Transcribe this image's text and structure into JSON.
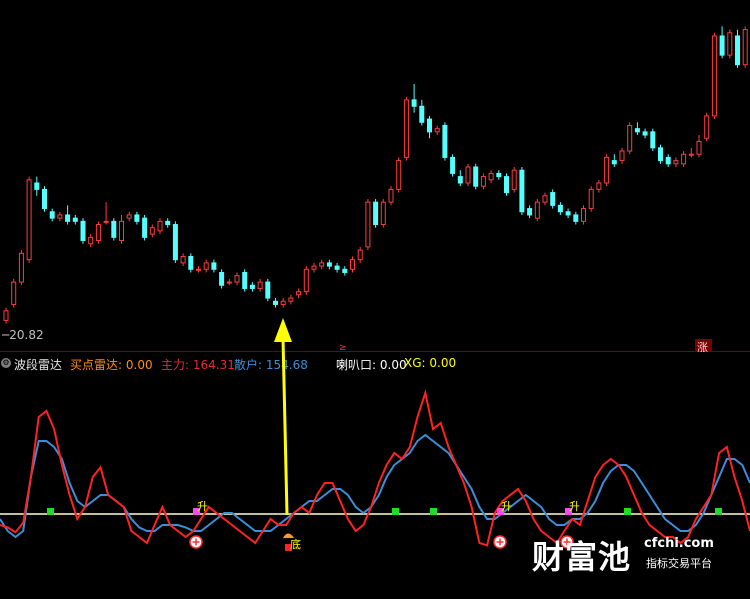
{
  "price_chart": {
    "last_price_label": "20.82",
    "marker_zhang": "涨",
    "marker_small": "≥",
    "bar_open": [
      19.3,
      19.8,
      20.5,
      21.2,
      23.6,
      23.4,
      22.7,
      22.5,
      22.6,
      22.5,
      22.4,
      21.7,
      21.8,
      22.4,
      22.4,
      21.8,
      22.5,
      22.6,
      22.5,
      22.0,
      22.1,
      22.4,
      22.3,
      21.1,
      21.3,
      20.9,
      20.9,
      21.1,
      20.8,
      20.5,
      20.5,
      20.8,
      20.4,
      20.3,
      20.5,
      19.9,
      19.8,
      19.9,
      20.1,
      20.2,
      20.9,
      21.0,
      21.1,
      21.0,
      20.9,
      20.9,
      21.2,
      21.6,
      23.0,
      22.3,
      23.0,
      23.4,
      24.4,
      26.2,
      26.0,
      25.6,
      25.2,
      25.4,
      24.4,
      23.8,
      23.6,
      24.1,
      23.5,
      23.7,
      23.9,
      23.8,
      23.4,
      24.0,
      22.8,
      22.5,
      23.0,
      23.3,
      22.9,
      22.7,
      22.6,
      22.4,
      22.8,
      23.4,
      23.6,
      24.3,
      24.3,
      24.6,
      25.3,
      25.2,
      25.2,
      24.7,
      24.4,
      24.2,
      24.2,
      24.5,
      24.5,
      25.0,
      25.7,
      28.2,
      27.6,
      28.2,
      27.3,
      28.3
    ],
    "bar_close": [
      19.6,
      20.5,
      21.4,
      23.7,
      23.4,
      22.8,
      22.5,
      22.6,
      22.4,
      22.4,
      21.8,
      21.9,
      22.3,
      22.4,
      21.9,
      22.4,
      22.6,
      22.4,
      21.9,
      22.2,
      22.4,
      22.3,
      21.2,
      21.3,
      20.9,
      20.9,
      21.1,
      20.9,
      20.4,
      20.5,
      20.7,
      20.3,
      20.3,
      20.5,
      20.0,
      19.8,
      19.9,
      20.0,
      20.2,
      20.9,
      21.0,
      21.1,
      21.0,
      20.9,
      20.8,
      21.2,
      21.5,
      23.0,
      22.3,
      23.0,
      23.4,
      24.3,
      26.2,
      26.0,
      25.5,
      25.2,
      25.3,
      24.4,
      23.9,
      23.6,
      24.1,
      23.5,
      23.8,
      23.9,
      23.8,
      23.3,
      24.0,
      22.7,
      22.6,
      23.0,
      23.2,
      22.9,
      22.7,
      22.6,
      22.4,
      22.8,
      23.4,
      23.6,
      24.4,
      24.2,
      24.6,
      25.4,
      25.2,
      25.1,
      24.7,
      24.3,
      24.2,
      24.3,
      24.5,
      24.5,
      24.9,
      25.7,
      28.2,
      27.6,
      28.3,
      27.3,
      28.4,
      27.6
    ],
    "bar_high": [
      19.7,
      20.6,
      21.5,
      23.8,
      23.8,
      23.5,
      22.8,
      22.7,
      22.9,
      22.6,
      22.5,
      22.0,
      22.4,
      23.0,
      22.5,
      22.6,
      22.7,
      22.7,
      22.6,
      22.3,
      22.5,
      22.5,
      22.4,
      21.4,
      21.4,
      21.0,
      21.2,
      21.2,
      20.9,
      20.6,
      20.8,
      20.9,
      20.5,
      20.6,
      20.6,
      20.0,
      20.0,
      20.1,
      20.3,
      21.0,
      21.1,
      21.2,
      21.2,
      21.1,
      21.0,
      21.3,
      21.6,
      23.1,
      23.1,
      23.1,
      23.5,
      24.4,
      26.3,
      26.7,
      26.2,
      25.7,
      25.4,
      25.5,
      24.5,
      24.0,
      24.2,
      24.2,
      23.9,
      24.0,
      24.0,
      23.9,
      24.1,
      24.1,
      22.9,
      23.1,
      23.3,
      23.4,
      23.0,
      22.8,
      22.7,
      22.9,
      23.5,
      23.7,
      24.5,
      24.5,
      24.7,
      25.5,
      25.5,
      25.3,
      25.3,
      24.8,
      24.5,
      24.4,
      24.6,
      24.7,
      25.1,
      25.8,
      28.3,
      28.5,
      28.4,
      28.4,
      28.5,
      28.5
    ],
    "bar_low": [
      19.2,
      19.7,
      20.4,
      21.1,
      23.2,
      22.7,
      22.4,
      22.4,
      22.3,
      22.3,
      21.7,
      21.6,
      21.7,
      22.3,
      21.8,
      21.7,
      22.4,
      22.3,
      21.8,
      21.9,
      22.0,
      22.2,
      21.1,
      21.0,
      20.8,
      20.8,
      20.8,
      20.8,
      20.3,
      20.4,
      20.4,
      20.2,
      20.2,
      20.2,
      19.9,
      19.7,
      19.7,
      19.8,
      20.0,
      20.1,
      20.8,
      20.9,
      20.9,
      20.8,
      20.7,
      20.8,
      21.1,
      21.5,
      22.2,
      22.2,
      22.9,
      23.3,
      24.3,
      25.8,
      25.4,
      25.0,
      25.1,
      24.3,
      23.8,
      23.5,
      23.5,
      23.4,
      23.4,
      23.6,
      23.7,
      23.2,
      23.3,
      22.6,
      22.5,
      22.4,
      22.9,
      22.8,
      22.6,
      22.5,
      22.3,
      22.3,
      22.7,
      23.3,
      23.5,
      24.1,
      24.2,
      24.5,
      25.1,
      25.0,
      24.6,
      24.2,
      24.1,
      24.1,
      24.1,
      24.4,
      24.4,
      24.9,
      25.6,
      27.5,
      27.5,
      27.2,
      27.2,
      27.5
    ]
  },
  "indicator": {
    "name": "波段雷达",
    "settings_icon": "gear-icon",
    "fields": [
      {
        "label": "买点雷达:",
        "value": "0.00",
        "color": "#ff8c1a"
      },
      {
        "label": "主力:",
        "value": "164.31",
        "color": "#e52b2b"
      },
      {
        "label": "散户:",
        "value": "154.68",
        "color": "#3b8fd9"
      },
      {
        "label": "喇叭口:",
        "value": "0.00",
        "color": "#ffffff"
      },
      {
        "label": "XG:",
        "value": "0.00",
        "color": "#ffff00"
      }
    ],
    "sheng_marker": "升",
    "di_marker": "底",
    "main_line": [
      20,
      18,
      14,
      22,
      60,
      110,
      115,
      100,
      70,
      45,
      25,
      35,
      60,
      68,
      45,
      40,
      35,
      15,
      10,
      5,
      20,
      35,
      20,
      15,
      10,
      15,
      25,
      35,
      30,
      25,
      20,
      15,
      10,
      5,
      15,
      25,
      20,
      20,
      30,
      35,
      30,
      45,
      55,
      55,
      40,
      25,
      15,
      20,
      35,
      55,
      70,
      80,
      75,
      85,
      110,
      130,
      100,
      105,
      85,
      70,
      55,
      35,
      5,
      3,
      30,
      40,
      45,
      50,
      40,
      25,
      15,
      10,
      5,
      15,
      25,
      20,
      40,
      60,
      70,
      75,
      70,
      60,
      45,
      30,
      20,
      15,
      10,
      10,
      5,
      10,
      25,
      35,
      45,
      80,
      85,
      60,
      40,
      15
    ],
    "retail_line": [
      25,
      15,
      10,
      15,
      60,
      90,
      90,
      85,
      75,
      55,
      40,
      35,
      40,
      45,
      45,
      40,
      35,
      25,
      18,
      15,
      15,
      20,
      20,
      20,
      18,
      15,
      15,
      20,
      25,
      30,
      30,
      25,
      20,
      15,
      15,
      15,
      20,
      25,
      30,
      35,
      40,
      40,
      45,
      50,
      50,
      45,
      35,
      30,
      35,
      45,
      60,
      70,
      75,
      80,
      90,
      95,
      90,
      85,
      80,
      70,
      60,
      50,
      35,
      25,
      25,
      30,
      35,
      40,
      45,
      40,
      35,
      25,
      20,
      20,
      25,
      25,
      30,
      40,
      55,
      65,
      70,
      70,
      65,
      55,
      45,
      35,
      25,
      20,
      15,
      15,
      20,
      30,
      45,
      60,
      75,
      75,
      70,
      55
    ]
  },
  "watermark": {
    "logo_text": "财富池",
    "site": "cfchi.com",
    "slogan": "指标交易平台"
  }
}
